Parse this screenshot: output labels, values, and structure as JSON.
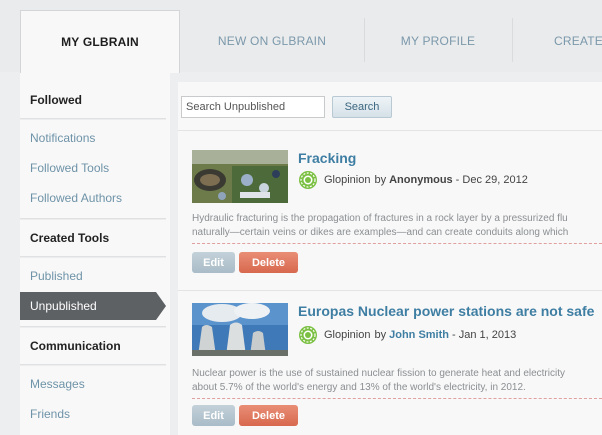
{
  "tabs": [
    {
      "label": "MY GLBRAIN",
      "active": true
    },
    {
      "label": "NEW ON GLBRAIN",
      "active": false
    },
    {
      "label": "MY PROFILE",
      "active": false
    },
    {
      "label": "CREATE G",
      "active": false
    }
  ],
  "sidebar": {
    "sections": [
      {
        "heading": "Followed",
        "items": [
          "Notifications",
          "Followed Tools",
          "Followed Authors"
        ]
      },
      {
        "heading": "Created Tools",
        "items": [
          "Published",
          "Unpublished"
        ]
      },
      {
        "heading": "Communication",
        "items": [
          "Messages",
          "Friends"
        ]
      }
    ],
    "selected_item": "Unpublished"
  },
  "search": {
    "placeholder": "Search Unpublished",
    "value": "",
    "button_label": "Search"
  },
  "items": [
    {
      "title": "Fracking",
      "tool_type": "Glopinion",
      "by": "by",
      "author": "Anonymous",
      "date": "- Dec 29, 2012",
      "description_line1": "Hydraulic fracturing is the propagation of fractures in a rock layer by a pressurized flu",
      "description_line2": "naturally—certain veins or dikes are examples—and can create conduits along which",
      "edit_label": "Edit",
      "delete_label": "Delete"
    },
    {
      "title": "Europas Nuclear power stations are not safe",
      "tool_type": "Glopinion",
      "by": "by",
      "author": "John Smith",
      "date": "- Jan 1, 2013",
      "description_line1": "Nuclear power is the use of sustained nuclear fission to generate heat and electricity",
      "description_line2": "about 5.7% of the world's energy and 13% of the world's electricity, in 2012.",
      "edit_label": "Edit",
      "delete_label": "Delete"
    }
  ],
  "colors": {
    "link": "#3f7ea3",
    "selected_bg": "#5d6164",
    "delete": "#d7684e",
    "edit": "#a9bcc7",
    "badge": "#7bc043"
  },
  "icons": {
    "badge": "glopinion-badge-icon"
  }
}
